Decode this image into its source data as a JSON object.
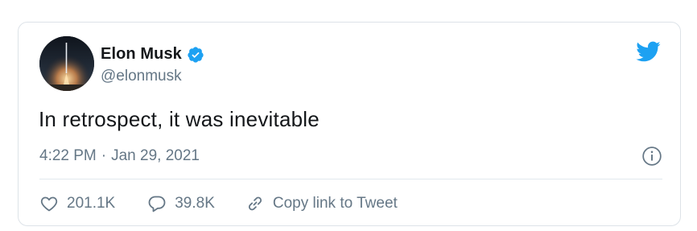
{
  "tweet": {
    "author": {
      "display_name": "Elon Musk",
      "handle": "@elonmusk",
      "verified": true,
      "avatar_icon": "rocket-launch-avatar"
    },
    "text": "In retrospect, it was inevitable",
    "time": "4:22 PM",
    "separator": "·",
    "date": "Jan 29, 2021",
    "stats": {
      "likes": "201.1K",
      "replies": "39.8K"
    },
    "copy_link_label": "Copy link to Tweet"
  },
  "icons": {
    "brand": "twitter-bird-icon",
    "verified": "verified-badge-icon",
    "info": "info-icon",
    "like": "heart-icon",
    "reply": "speech-bubble-icon",
    "link": "link-icon"
  },
  "colors": {
    "brand_blue": "#1da1f2",
    "text_primary": "#14171a",
    "text_secondary": "#657786",
    "border": "#dde3e8"
  }
}
